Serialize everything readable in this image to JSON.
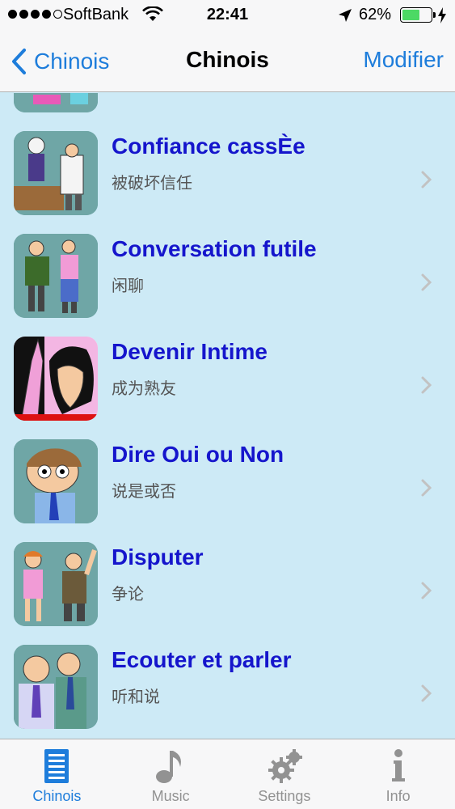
{
  "status_bar": {
    "carrier": "SoftBank",
    "time": "22:41",
    "battery_percent": "62%",
    "battery_level": 0.62,
    "signal_bars": 4
  },
  "nav": {
    "back_label": "Chinois",
    "title": "Chinois",
    "edit_label": "Modifier"
  },
  "list": {
    "items": [
      {
        "title": "Confiance cassÈe",
        "subtitle": "被破坏信任",
        "icon": "thumbnail-broken-trust"
      },
      {
        "title": "Conversation futile",
        "subtitle": "闲聊",
        "icon": "thumbnail-chat"
      },
      {
        "title": "Devenir Intime",
        "subtitle": "成为熟友",
        "icon": "thumbnail-intimate"
      },
      {
        "title": "Dire Oui ou Non",
        "subtitle": "说是或否",
        "icon": "thumbnail-yes-no"
      },
      {
        "title": "Disputer",
        "subtitle": "争论",
        "icon": "thumbnail-dispute"
      },
      {
        "title": "Ecouter et parler",
        "subtitle": "听和说",
        "icon": "thumbnail-listen-speak"
      }
    ]
  },
  "tab_bar": {
    "tabs": [
      {
        "label": "Chinois",
        "icon": "list-icon",
        "active": true
      },
      {
        "label": "Music",
        "icon": "music-note-icon",
        "active": false
      },
      {
        "label": "Settings",
        "icon": "gear-icon",
        "active": false
      },
      {
        "label": "Info",
        "icon": "info-icon",
        "active": false
      }
    ]
  },
  "colors": {
    "accent": "#1e7ddb",
    "list_background": "#cdeaf6",
    "title_text": "#1515cc",
    "battery": "#4cd964"
  }
}
